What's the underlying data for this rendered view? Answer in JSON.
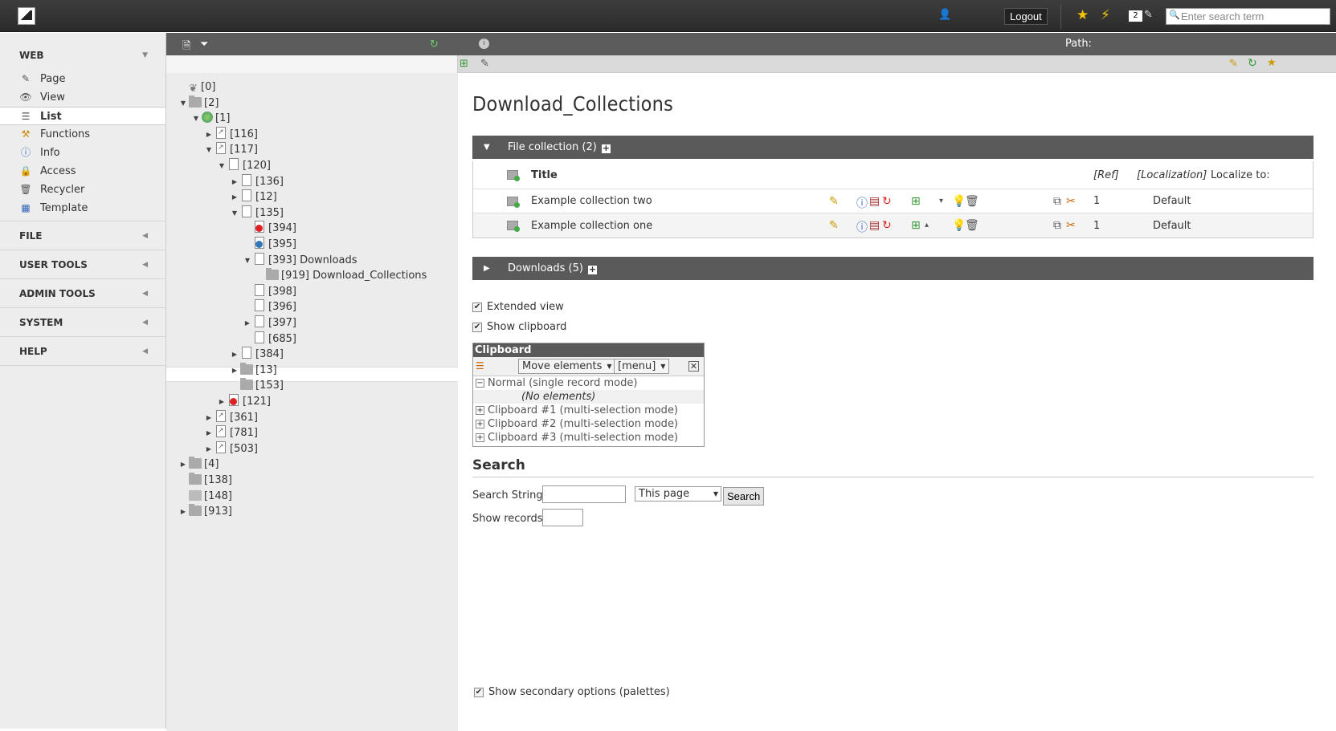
{
  "topbar": {
    "logout_label": "Logout",
    "task_count": "2",
    "search_placeholder": "Enter search term"
  },
  "module_menu": {
    "groups": [
      {
        "label": "WEB",
        "items": [
          {
            "label": "Page",
            "icon": "page-edit-icon"
          },
          {
            "label": "View",
            "icon": "eye-icon"
          },
          {
            "label": "List",
            "icon": "list-icon",
            "active": true
          },
          {
            "label": "Functions",
            "icon": "wand-icon"
          },
          {
            "label": "Info",
            "icon": "info-icon"
          },
          {
            "label": "Access",
            "icon": "lock-icon"
          },
          {
            "label": "Recycler",
            "icon": "recycler-icon"
          },
          {
            "label": "Template",
            "icon": "template-icon"
          }
        ]
      },
      {
        "label": "FILE"
      },
      {
        "label": "USER TOOLS"
      },
      {
        "label": "ADMIN TOOLS"
      },
      {
        "label": "SYSTEM"
      },
      {
        "label": "HELP"
      }
    ]
  },
  "page_tree": {
    "nodes": [
      {
        "label": "[0]",
        "depth": 0,
        "icon": "root",
        "toggle": ""
      },
      {
        "label": "[2]",
        "depth": 0,
        "icon": "folder",
        "toggle": "open"
      },
      {
        "label": "[1]",
        "depth": 1,
        "icon": "globe",
        "toggle": "open"
      },
      {
        "label": "[116]",
        "depth": 2,
        "icon": "pagelink",
        "toggle": "closed"
      },
      {
        "label": "[117]",
        "depth": 2,
        "icon": "pagelink",
        "toggle": "open"
      },
      {
        "label": "[120]",
        "depth": 3,
        "icon": "page",
        "toggle": "open"
      },
      {
        "label": "[136]",
        "depth": 4,
        "icon": "page",
        "toggle": "closed"
      },
      {
        "label": "[12]",
        "depth": 4,
        "icon": "page",
        "toggle": "closed"
      },
      {
        "label": "[135]",
        "depth": 4,
        "icon": "page",
        "toggle": "open"
      },
      {
        "label": "[394]",
        "depth": 5,
        "icon": "pagered",
        "toggle": ""
      },
      {
        "label": "[395]",
        "depth": 5,
        "icon": "pageblue",
        "toggle": ""
      },
      {
        "label": "[393] Downloads",
        "depth": 5,
        "icon": "page",
        "toggle": "open"
      },
      {
        "label": "[919] Download_Collections",
        "depth": 6,
        "icon": "folder",
        "toggle": "",
        "selected": true
      },
      {
        "label": "[398]",
        "depth": 5,
        "icon": "page",
        "toggle": ""
      },
      {
        "label": "[396]",
        "depth": 5,
        "icon": "page",
        "toggle": ""
      },
      {
        "label": "[397]",
        "depth": 5,
        "icon": "page",
        "toggle": "closed"
      },
      {
        "label": "[685]",
        "depth": 5,
        "icon": "page",
        "toggle": ""
      },
      {
        "label": "[384]",
        "depth": 4,
        "icon": "page",
        "toggle": "closed"
      },
      {
        "label": "[13]",
        "depth": 4,
        "icon": "folder",
        "toggle": "closed"
      },
      {
        "label": "[153]",
        "depth": 4,
        "icon": "folder",
        "toggle": ""
      },
      {
        "label": "[121]",
        "depth": 3,
        "icon": "pagered",
        "toggle": "closed"
      },
      {
        "label": "[361]",
        "depth": 2,
        "icon": "pagelink",
        "toggle": "closed"
      },
      {
        "label": "[781]",
        "depth": 2,
        "icon": "pagelink",
        "toggle": "closed"
      },
      {
        "label": "[503]",
        "depth": 2,
        "icon": "pagelink",
        "toggle": "closed"
      },
      {
        "label": "[4]",
        "depth": 0,
        "icon": "folder",
        "toggle": "closed"
      },
      {
        "label": "[138]",
        "depth": 0,
        "icon": "folder",
        "toggle": ""
      },
      {
        "label": "[148]",
        "depth": 0,
        "icon": "shortcut",
        "toggle": ""
      },
      {
        "label": "[913]",
        "depth": 0,
        "icon": "folder",
        "toggle": "closed"
      }
    ]
  },
  "doc_header": {
    "path_label": "Path:"
  },
  "content": {
    "title": "Download_Collections",
    "file_collection": {
      "label": "File collection (2)",
      "col_title": "Title",
      "col_ref": "[Ref]",
      "col_localization": "[Localization]",
      "col_localize_to": "Localize to:",
      "rows": [
        {
          "title": "Example collection two",
          "ref": "1",
          "localize": "Default"
        },
        {
          "title": "Example collection one",
          "ref": "1",
          "localize": "Default"
        }
      ]
    },
    "downloads": {
      "label": "Downloads (5)"
    },
    "extended_view_label": "Extended view",
    "show_clipboard_label": "Show clipboard",
    "clipboard": {
      "title": "Clipboard",
      "move_select": "Move elements",
      "menu_select": "[menu]",
      "normal_label": "Normal (single record mode)",
      "no_elements": "(No elements)",
      "pads": [
        "Clipboard #1 (multi-selection mode)",
        "Clipboard #2 (multi-selection mode)",
        "Clipboard #3 (multi-selection mode)"
      ]
    },
    "search": {
      "heading": "Search",
      "string_label": "Search String:",
      "scope_value": "This page",
      "button_label": "Search",
      "show_records_label": "Show records:"
    },
    "secondary_options_label": "Show secondary options (palettes)"
  }
}
